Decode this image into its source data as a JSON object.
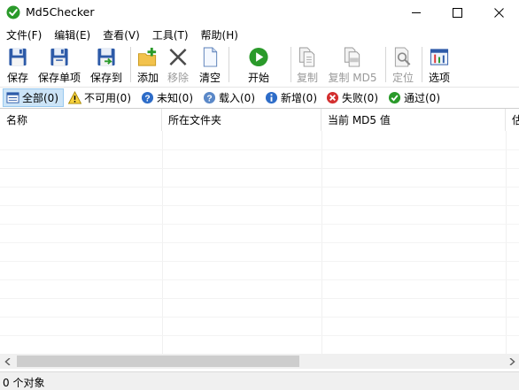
{
  "window": {
    "title": "Md5Checker"
  },
  "menu": [
    "文件(F)",
    "编辑(E)",
    "查看(V)",
    "工具(T)",
    "帮助(H)"
  ],
  "toolbar": {
    "save": "保存",
    "save_item": "保存单项",
    "save_to": "保存到",
    "add": "添加",
    "remove": "移除",
    "clear": "清空",
    "start": "开始",
    "copy": "复制",
    "copy_md5": "复制 MD5",
    "locate": "定位",
    "options": "选项"
  },
  "filters": {
    "all": "全部(0)",
    "unavailable": "不可用(0)",
    "unknown": "未知(0)",
    "loaded": "载入(0)",
    "new": "新增(0)",
    "failed": "失败(0)",
    "passed": "通过(0)"
  },
  "columns": [
    "名称",
    "所在文件夹",
    "当前 MD5 值",
    "估"
  ],
  "status": {
    "objects": "0 个对象"
  },
  "colors": {
    "accent": "#0078d7",
    "active_tab_bg": "#cce4f7",
    "ok_green": "#2a9a2a",
    "fail_red": "#d32f2f"
  }
}
